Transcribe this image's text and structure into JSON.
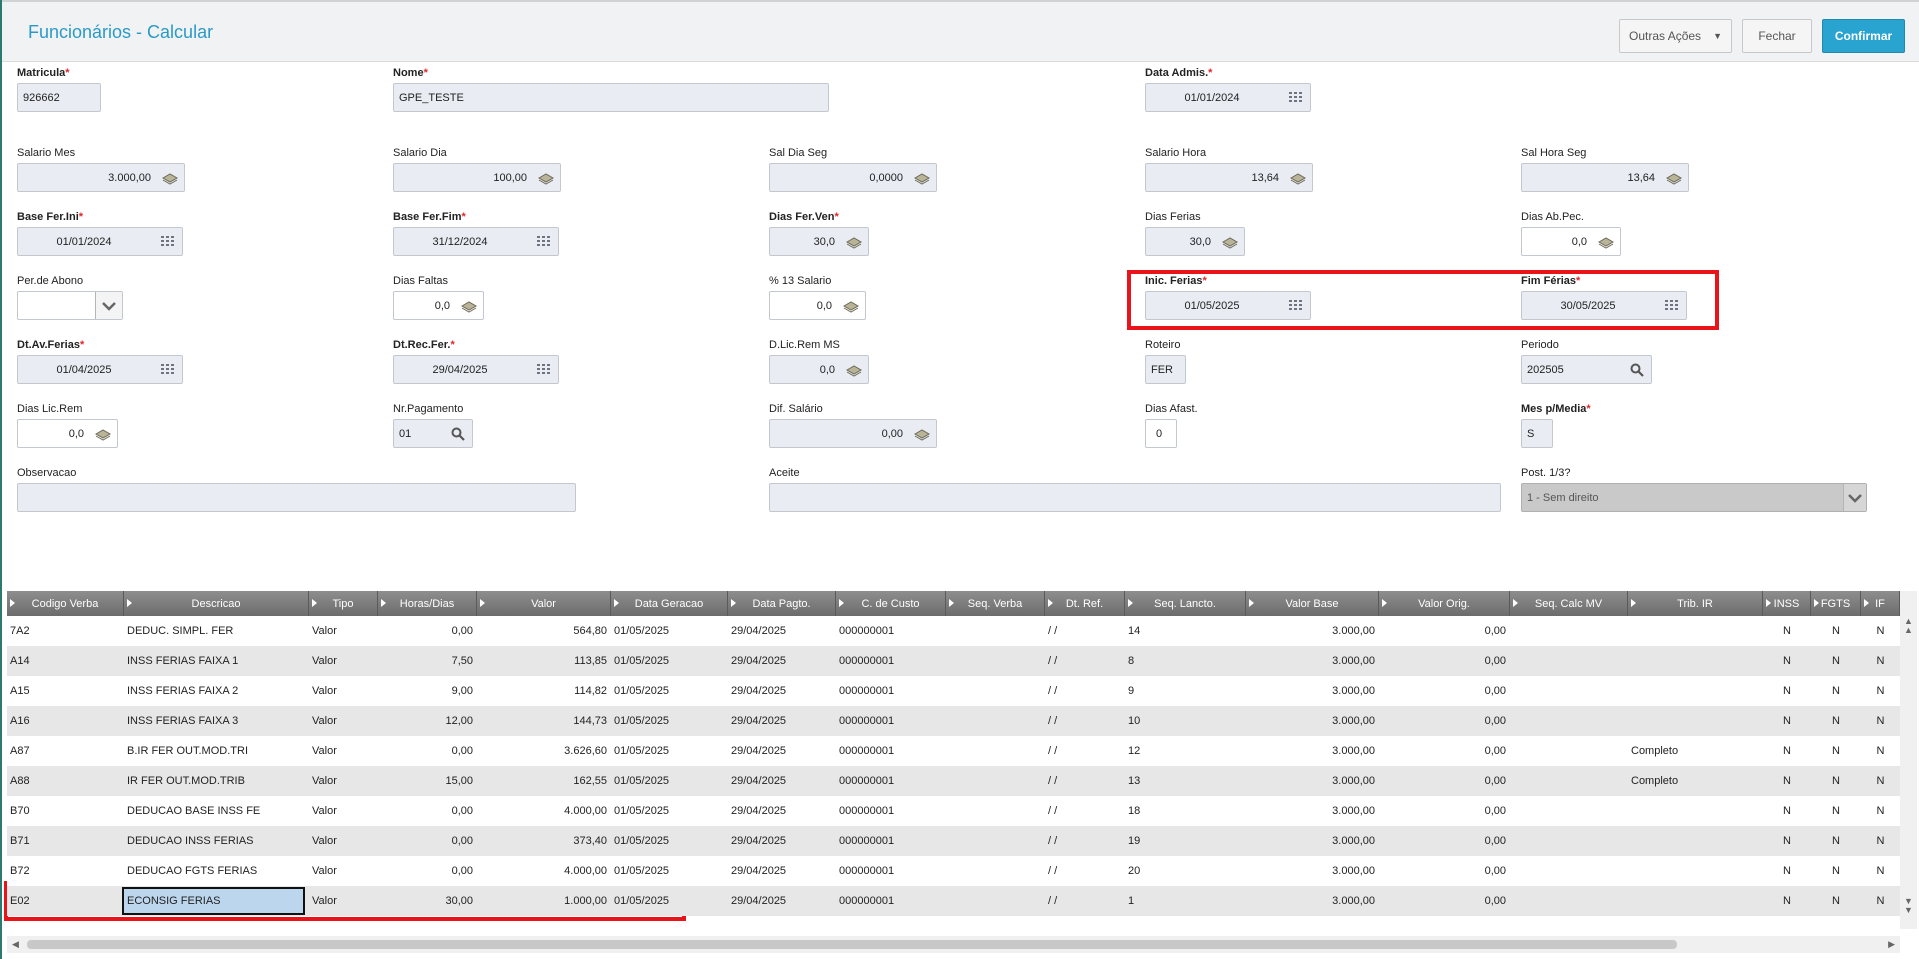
{
  "header": {
    "title": "Funcionários - Calcular",
    "more_actions": "Outras Ações",
    "close": "Fechar",
    "confirm": "Confirmar"
  },
  "form": {
    "matricula": {
      "label": "Matricula",
      "value": "926662"
    },
    "nome": {
      "label": "Nome",
      "value": "GPE_TESTE"
    },
    "data_admis": {
      "label": "Data Admis.",
      "value": "01/01/2024"
    },
    "salario_mes": {
      "label": "Salario Mes",
      "value": "3.000,00"
    },
    "salario_dia": {
      "label": "Salario Dia",
      "value": "100,00"
    },
    "sal_dia_seg": {
      "label": "Sal Dia Seg",
      "value": "0,0000"
    },
    "salario_hora": {
      "label": "Salario Hora",
      "value": "13,64"
    },
    "sal_hora_seg": {
      "label": "Sal Hora Seg",
      "value": "13,64"
    },
    "base_fer_ini": {
      "label": "Base Fer.Ini",
      "value": "01/01/2024"
    },
    "base_fer_fim": {
      "label": "Base Fer.Fim",
      "value": "31/12/2024"
    },
    "dias_fer_ven": {
      "label": "Dias Fer.Ven",
      "value": "30,0"
    },
    "dias_ferias": {
      "label": "Dias Ferias",
      "value": "30,0"
    },
    "dias_ab_pec": {
      "label": "Dias Ab.Pec.",
      "value": "0,0"
    },
    "per_abono": {
      "label": "Per.de Abono",
      "value": ""
    },
    "dias_faltas": {
      "label": "Dias Faltas",
      "value": "0,0"
    },
    "pct_13_salario": {
      "label": "% 13 Salario",
      "value": "0,0"
    },
    "inic_ferias": {
      "label": "Inic. Ferias",
      "value": "01/05/2025"
    },
    "fim_ferias": {
      "label": "Fim Férias",
      "value": "30/05/2025"
    },
    "dt_av_ferias": {
      "label": "Dt.Av.Ferias",
      "value": "01/04/2025"
    },
    "dt_rec_fer": {
      "label": "Dt.Rec.Fer.",
      "value": "29/04/2025"
    },
    "d_lic_rem_ms": {
      "label": "D.Lic.Rem MS",
      "value": "0,0"
    },
    "roteiro": {
      "label": "Roteiro",
      "value": "FER"
    },
    "periodo": {
      "label": "Periodo",
      "value": "202505"
    },
    "dias_lic_rem": {
      "label": "Dias Lic.Rem",
      "value": "0,0"
    },
    "nr_pagamento": {
      "label": "Nr.Pagamento",
      "value": "01"
    },
    "dif_salario": {
      "label": "Dif. Salário",
      "value": "0,00"
    },
    "dias_afast": {
      "label": "Dias Afast.",
      "value": "0"
    },
    "mes_p_media": {
      "label": "Mes p/Media",
      "value": "S"
    },
    "observacao": {
      "label": "Observacao",
      "value": ""
    },
    "aceite": {
      "label": "Aceite",
      "value": ""
    },
    "post_13": {
      "label": "Post. 1/3?",
      "value": "1 - Sem direito"
    }
  },
  "grid": {
    "columns": [
      "Codigo Verba",
      "Descricao",
      "Tipo",
      "Horas/Dias",
      "Valor",
      "Data Geracao",
      "Data Pagto.",
      "C. de Custo",
      "Seq. Verba",
      "Dt. Ref.",
      "Seq. Lancto.",
      "Valor Base",
      "Valor Orig.",
      "Seq. Calc MV",
      "Trib. IR",
      "INSS",
      "FGTS",
      "IF"
    ],
    "rows": [
      [
        "7A2",
        "DEDUC. SIMPL. FER",
        "Valor",
        "0,00",
        "564,80",
        "01/05/2025",
        "29/04/2025",
        "000000001",
        "",
        "/ /",
        "14",
        "3.000,00",
        "0,00",
        "",
        "",
        "N",
        "N",
        "N"
      ],
      [
        "A14",
        "INSS FERIAS FAIXA 1",
        "Valor",
        "7,50",
        "113,85",
        "01/05/2025",
        "29/04/2025",
        "000000001",
        "",
        "/ /",
        "8",
        "3.000,00",
        "0,00",
        "",
        "",
        "N",
        "N",
        "N"
      ],
      [
        "A15",
        "INSS FERIAS FAIXA 2",
        "Valor",
        "9,00",
        "114,82",
        "01/05/2025",
        "29/04/2025",
        "000000001",
        "",
        "/ /",
        "9",
        "3.000,00",
        "0,00",
        "",
        "",
        "N",
        "N",
        "N"
      ],
      [
        "A16",
        "INSS FERIAS FAIXA 3",
        "Valor",
        "12,00",
        "144,73",
        "01/05/2025",
        "29/04/2025",
        "000000001",
        "",
        "/ /",
        "10",
        "3.000,00",
        "0,00",
        "",
        "",
        "N",
        "N",
        "N"
      ],
      [
        "A87",
        "B.IR FER OUT.MOD.TRI",
        "Valor",
        "0,00",
        "3.626,60",
        "01/05/2025",
        "29/04/2025",
        "000000001",
        "",
        "/ /",
        "12",
        "3.000,00",
        "0,00",
        "",
        "Completo",
        "N",
        "N",
        "N"
      ],
      [
        "A88",
        "IR FER OUT.MOD.TRIB",
        "Valor",
        "15,00",
        "162,55",
        "01/05/2025",
        "29/04/2025",
        "000000001",
        "",
        "/ /",
        "13",
        "3.000,00",
        "0,00",
        "",
        "Completo",
        "N",
        "N",
        "N"
      ],
      [
        "B70",
        "DEDUCAO BASE INSS FE",
        "Valor",
        "0,00",
        "4.000,00",
        "01/05/2025",
        "29/04/2025",
        "000000001",
        "",
        "/ /",
        "18",
        "3.000,00",
        "0,00",
        "",
        "",
        "N",
        "N",
        "N"
      ],
      [
        "B71",
        "DEDUCAO INSS FERIAS",
        "Valor",
        "0,00",
        "373,40",
        "01/05/2025",
        "29/04/2025",
        "000000001",
        "",
        "/ /",
        "19",
        "3.000,00",
        "0,00",
        "",
        "",
        "N",
        "N",
        "N"
      ],
      [
        "B72",
        "DEDUCAO FGTS FERIAS",
        "Valor",
        "0,00",
        "4.000,00",
        "01/05/2025",
        "29/04/2025",
        "000000001",
        "",
        "/ /",
        "20",
        "3.000,00",
        "0,00",
        "",
        "",
        "N",
        "N",
        "N"
      ],
      [
        "E02",
        "ECONSIG FERIAS",
        "Valor",
        "30,00",
        "1.000,00",
        "01/05/2025",
        "29/04/2025",
        "000000001",
        "",
        "/ /",
        "1",
        "3.000,00",
        "0,00",
        "",
        "",
        "N",
        "N",
        "N"
      ]
    ]
  }
}
